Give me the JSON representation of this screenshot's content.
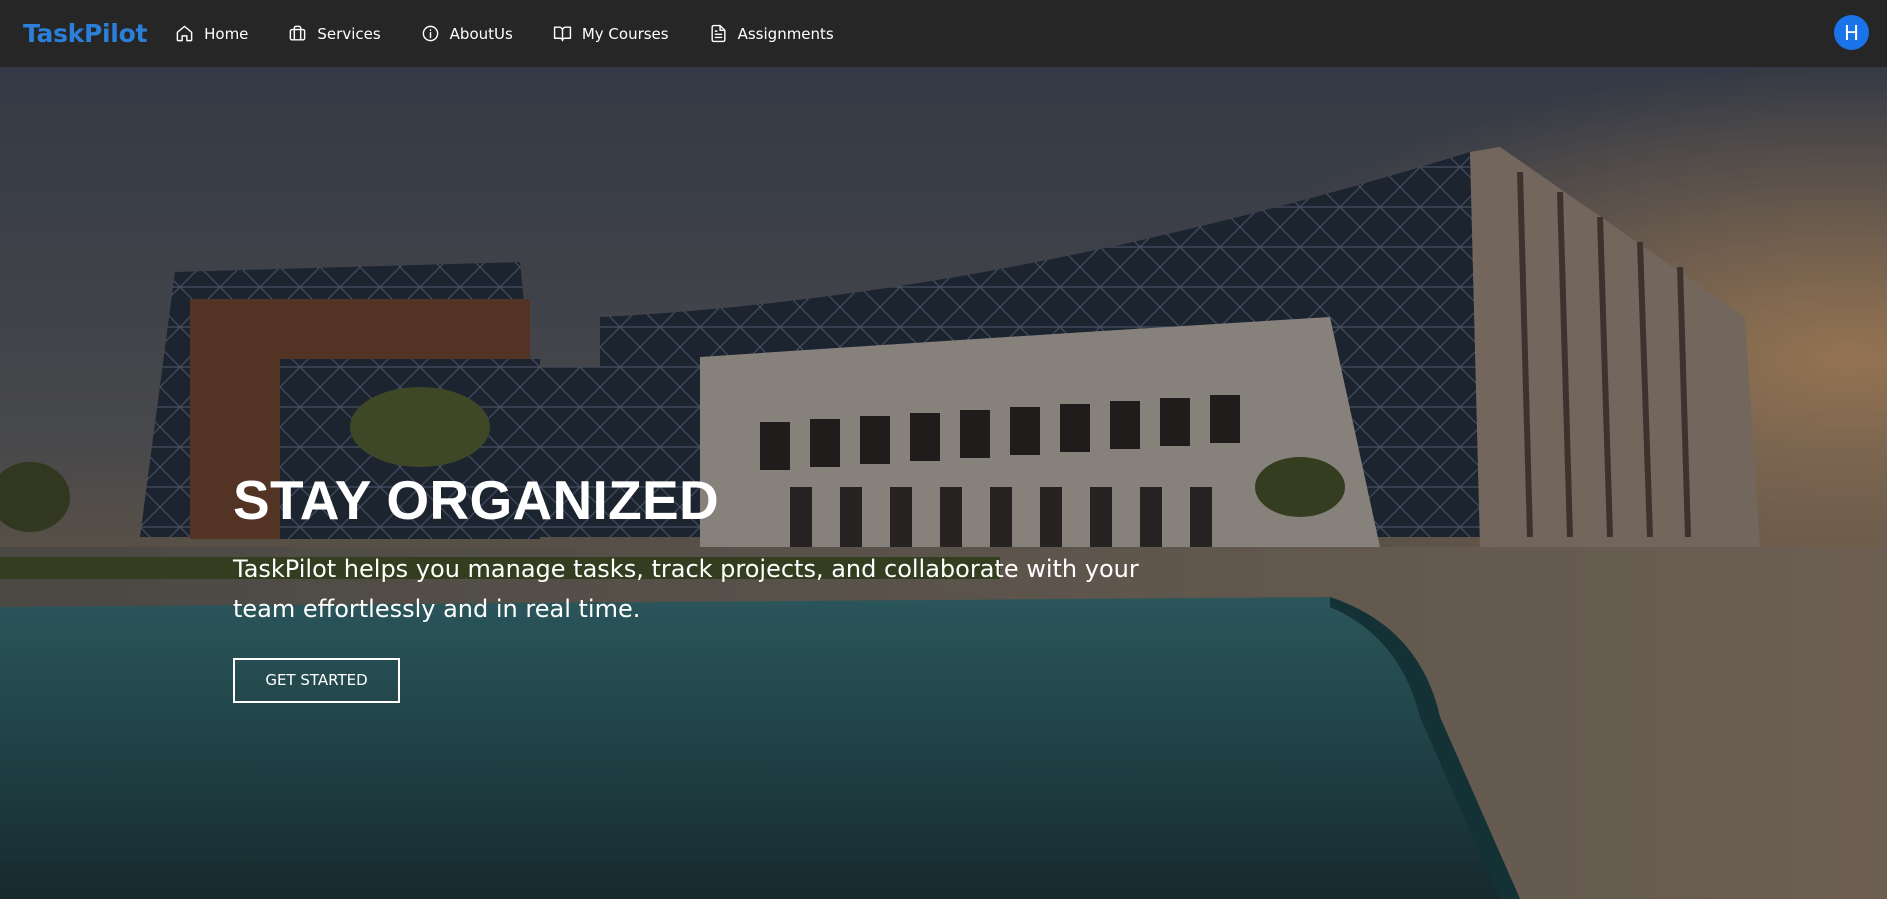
{
  "navbar": {
    "brand": "TaskPilot",
    "items": [
      {
        "label": "Home",
        "icon": "home-icon"
      },
      {
        "label": "Services",
        "icon": "briefcase-icon"
      },
      {
        "label": "AboutUs",
        "icon": "info-icon"
      },
      {
        "label": "My Courses",
        "icon": "book-icon"
      },
      {
        "label": "Assignments",
        "icon": "document-icon"
      }
    ],
    "avatar_initial": "H"
  },
  "hero": {
    "title": "STAY ORGANIZED",
    "text": "TaskPilot helps you manage tasks, track projects, and collaborate with your team effortlessly and in real time.",
    "button_label": "GET STARTED"
  },
  "colors": {
    "navbar_bg": "#262626",
    "brand": "#2b7fd9",
    "avatar_bg": "#1a73e8",
    "text": "#ffffff"
  }
}
